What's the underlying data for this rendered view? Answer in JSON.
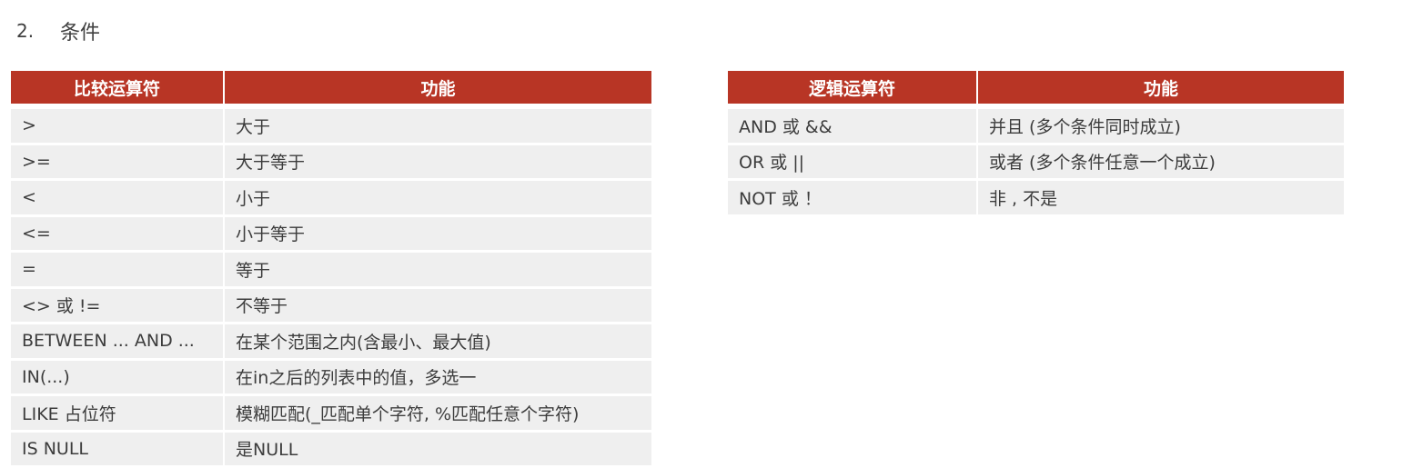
{
  "heading": {
    "number": "2.",
    "title": "条件"
  },
  "comparison_table": {
    "headers": [
      "比较运算符",
      "功能"
    ],
    "rows": [
      [
        ">",
        "大于"
      ],
      [
        ">=",
        "大于等于"
      ],
      [
        "<",
        "小于"
      ],
      [
        "<=",
        "小于等于"
      ],
      [
        "=",
        "等于"
      ],
      [
        "<> 或 !=",
        "不等于"
      ],
      [
        "BETWEEN ... AND ...",
        "在某个范围之内(含最小、最大值)"
      ],
      [
        "IN(...)",
        "在in之后的列表中的值，多选一"
      ],
      [
        "LIKE  占位符",
        "模糊匹配(_匹配单个字符, %匹配任意个字符)"
      ],
      [
        "IS NULL",
        "是NULL"
      ]
    ]
  },
  "logic_table": {
    "headers": [
      "逻辑运算符",
      "功能"
    ],
    "rows": [
      [
        "AND  或  &&",
        "并且 (多个条件同时成立)"
      ],
      [
        "OR  或  ||",
        "或者 (多个条件任意一个成立)"
      ],
      [
        "NOT  或  ！",
        "非 , 不是"
      ]
    ]
  },
  "colors": {
    "header_bg": "#b83525",
    "header_text": "#ffffff",
    "row_bg": "#efefef"
  }
}
